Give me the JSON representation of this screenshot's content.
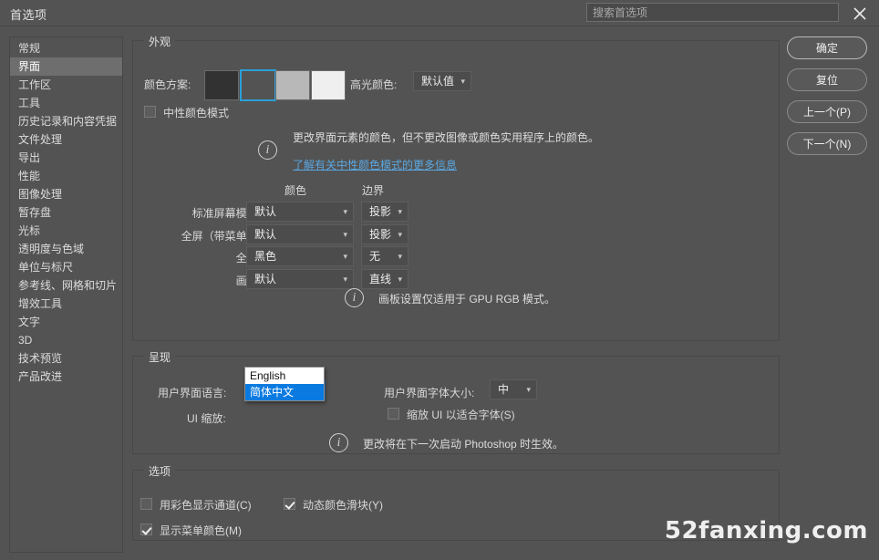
{
  "window": {
    "title": "首选项",
    "search_placeholder": "搜索首选项",
    "close_icon": "close-icon"
  },
  "sidebar": {
    "items": [
      {
        "label": "常规",
        "selected": false
      },
      {
        "label": "界面",
        "selected": true
      },
      {
        "label": "工作区",
        "selected": false
      },
      {
        "label": "工具",
        "selected": false
      },
      {
        "label": "历史记录和内容凭据",
        "selected": false
      },
      {
        "label": "文件处理",
        "selected": false
      },
      {
        "label": "导出",
        "selected": false
      },
      {
        "label": "性能",
        "selected": false
      },
      {
        "label": "图像处理",
        "selected": false
      },
      {
        "label": "暂存盘",
        "selected": false
      },
      {
        "label": "光标",
        "selected": false
      },
      {
        "label": "透明度与色域",
        "selected": false
      },
      {
        "label": "单位与标尺",
        "selected": false
      },
      {
        "label": "参考线、网格和切片",
        "selected": false
      },
      {
        "label": "增效工具",
        "selected": false
      },
      {
        "label": "文字",
        "selected": false
      },
      {
        "label": "3D",
        "selected": false
      },
      {
        "label": "技术预览",
        "selected": false
      },
      {
        "label": "产品改进",
        "selected": false
      }
    ]
  },
  "appearance": {
    "group_title": "外观",
    "color_scheme_label": "颜色方案:",
    "swatches": [
      {
        "name": "dark",
        "color": "#323232",
        "selected": false
      },
      {
        "name": "medium-dark",
        "color": "#535353",
        "selected": true
      },
      {
        "name": "light",
        "color": "#b8b8b8",
        "selected": false
      },
      {
        "name": "lightest",
        "color": "#efefef",
        "selected": false
      }
    ],
    "highlight_color_label": "高光颜色:",
    "highlight_color_value": "默认值",
    "neutral_mode_label": "中性颜色模式",
    "neutral_mode_checked": false,
    "neutral_note": "更改界面元素的颜色，但不更改图像或颜色实用程序上的颜色。",
    "neutral_link": "了解有关中性颜色模式的更多信息",
    "col_header_color": "颜色",
    "col_header_border": "边界",
    "rows": [
      {
        "label": "标准屏幕模式:",
        "color": "默认",
        "border": "投影"
      },
      {
        "label": "全屏（带菜单）:",
        "color": "默认",
        "border": "投影"
      },
      {
        "label": "全屏:",
        "color": "黑色",
        "border": "无"
      },
      {
        "label": "画板:",
        "color": "默认",
        "border": "直线"
      }
    ],
    "gpu_note": "画板设置仅适用于 GPU RGB 模式。"
  },
  "presentation": {
    "group_title": "呈现",
    "ui_language_label": "用户界面语言:",
    "ui_language_value": "简体中文",
    "ui_language_options": [
      {
        "label": "English",
        "highlighted": false
      },
      {
        "label": "简体中文",
        "highlighted": true
      }
    ],
    "ui_scale_label": "UI 缩放:",
    "ui_font_size_label": "用户界面字体大小:",
    "ui_font_size_value": "中",
    "scale_ui_label": "缩放 UI 以适合字体(S)",
    "scale_ui_checked": false,
    "restart_note": "更改将在下一次启动 Photoshop 时生效。"
  },
  "options": {
    "group_title": "选项",
    "items": [
      {
        "label": "用彩色显示通道(C)",
        "checked": false
      },
      {
        "label": "动态颜色滑块(Y)",
        "checked": true
      },
      {
        "label": "显示菜单颜色(M)",
        "checked": true
      }
    ]
  },
  "buttons": [
    {
      "label": "确定",
      "primary": true
    },
    {
      "label": "复位",
      "primary": false
    },
    {
      "label": "上一个(P)",
      "primary": false
    },
    {
      "label": "下一个(N)",
      "primary": false
    }
  ],
  "watermark": "52fanxing.com"
}
